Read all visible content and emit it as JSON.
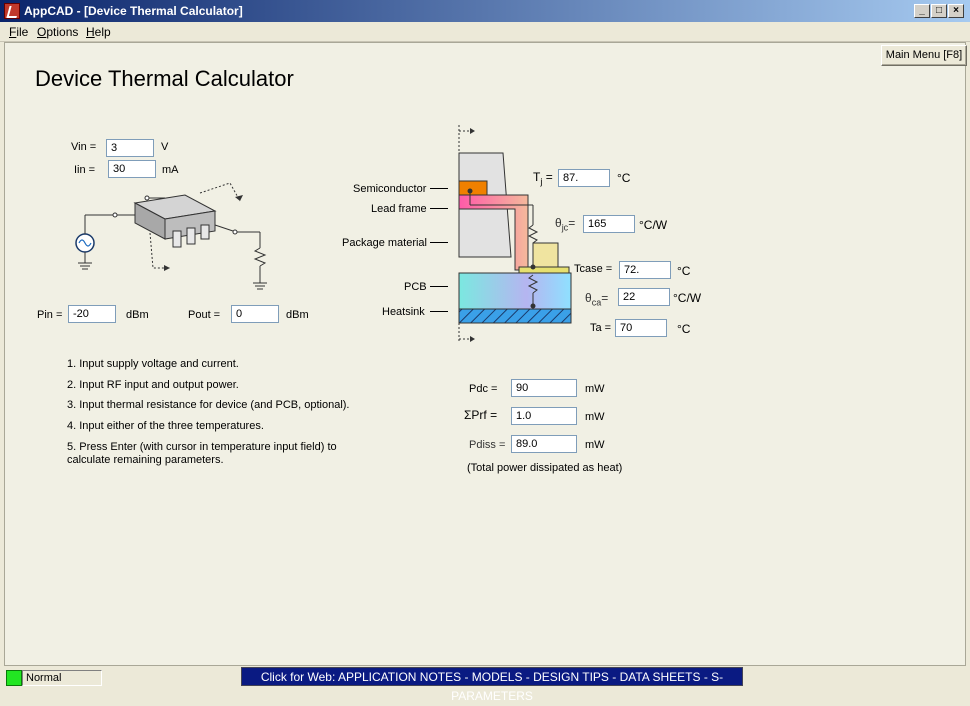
{
  "window": {
    "title": "AppCAD - [Device Thermal Calculator]",
    "controls": [
      "_",
      "□",
      "×"
    ]
  },
  "menu": [
    "File",
    "Options",
    "Help"
  ],
  "main_menu_button": "Main Menu [F8]",
  "heading": "Device Thermal Calculator",
  "inputs": {
    "vin": {
      "label": "Vin =",
      "value": "3",
      "unit": "V"
    },
    "iin": {
      "label": "Iin =",
      "value": "30",
      "unit": "mA"
    },
    "pin": {
      "label": "Pin =",
      "value": "-20",
      "unit": "dBm"
    },
    "pout": {
      "label": "Pout =",
      "value": "0",
      "unit": "dBm"
    }
  },
  "thermal": {
    "labels": {
      "semiconductor": "Semiconductor",
      "lead_frame": "Lead frame",
      "package_material": "Package material",
      "pcb": "PCB",
      "heatsink": "Heatsink"
    },
    "tj": {
      "label": "T",
      "sub": "j",
      "eq": "=",
      "value": "87.",
      "unit": "°C"
    },
    "theta_jc": {
      "label": "θ",
      "sub": "jc",
      "eq": "=",
      "value": "165",
      "unit": "°C/W"
    },
    "tcase": {
      "label": "Tcase =",
      "value": "72.",
      "unit": "°C"
    },
    "theta_ca": {
      "label": "θ",
      "sub": "ca",
      "eq": "=",
      "value": "22",
      "unit": "°C/W"
    },
    "ta": {
      "label": "Ta =",
      "value": "70",
      "unit": "°C"
    }
  },
  "power": {
    "pdc": {
      "label": "Pdc =",
      "value": "90",
      "unit": "mW"
    },
    "prf": {
      "label": "ΣPrf =",
      "value": "1.0",
      "unit": "mW"
    },
    "pdiss": {
      "label": "Pdiss =",
      "value": "89.0",
      "unit": "mW"
    },
    "note": "(Total power dissipated as heat)"
  },
  "steps": [
    "1.  Input supply voltage and current.",
    "2.  Input RF input and output power.",
    "3.  Input thermal resistance for device (and PCB, optional).",
    "4.  Input either of the three temperatures.",
    "5.  Press Enter (with cursor in temperature input field) to",
    "calculate remaining parameters."
  ],
  "status": {
    "mode": "Normal",
    "weblink": "Click for Web: APPLICATION NOTES - MODELS - DESIGN TIPS - DATA SHEETS - S-PARAMETERS",
    "led_color": "#22e622"
  }
}
